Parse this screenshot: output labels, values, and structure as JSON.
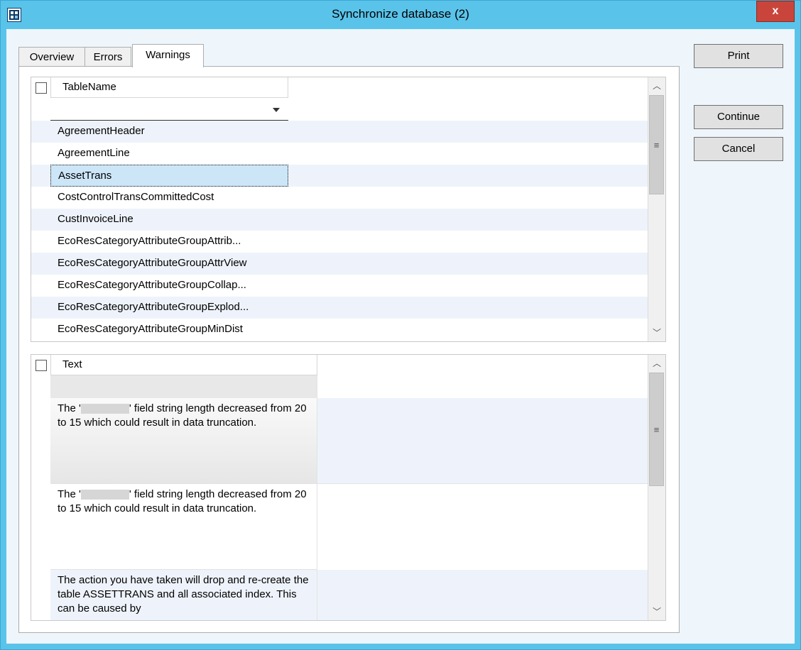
{
  "window": {
    "title": "Synchronize database (2)",
    "close_label": "x"
  },
  "tabs": [
    {
      "label": "Overview"
    },
    {
      "label": "Errors"
    },
    {
      "label": "Warnings"
    }
  ],
  "table_grid": {
    "column_header": "TableName",
    "rows": [
      "AgreementHeader",
      "AgreementLine",
      "AssetTrans",
      "CostControlTransCommittedCost",
      "CustInvoiceLine",
      "EcoResCategoryAttributeGroupAttrib...",
      "EcoResCategoryAttributeGroupAttrView",
      "EcoResCategoryAttributeGroupCollap...",
      "EcoResCategoryAttributeGroupExplod...",
      "EcoResCategoryAttributeGroupMinDist"
    ],
    "selected_index": 2
  },
  "text_grid": {
    "column_header": "Text",
    "rows": [
      {
        "prefix": "The '",
        "suffix": "' field string length decreased from 20 to 15 which could result in data truncation."
      },
      {
        "prefix": "The '",
        "suffix": "' field string length decreased from 20 to 15 which could result in data truncation."
      },
      {
        "text": "The action you have taken will drop and re-create the table ASSETTRANS and all associated index. This can be caused by"
      }
    ]
  },
  "buttons": {
    "print": "Print",
    "continue": "Continue",
    "cancel": "Cancel"
  },
  "icons": {
    "app": "dynamics-ax-icon",
    "scroll_up": "chevron-up-icon",
    "scroll_down": "chevron-down-icon",
    "dropdown": "dropdown-arrow-icon"
  },
  "colors": {
    "titlebar": "#5ac3ea",
    "close": "#c9453b",
    "selection": "#cce6f8",
    "alt_row": "#eef3fb"
  }
}
